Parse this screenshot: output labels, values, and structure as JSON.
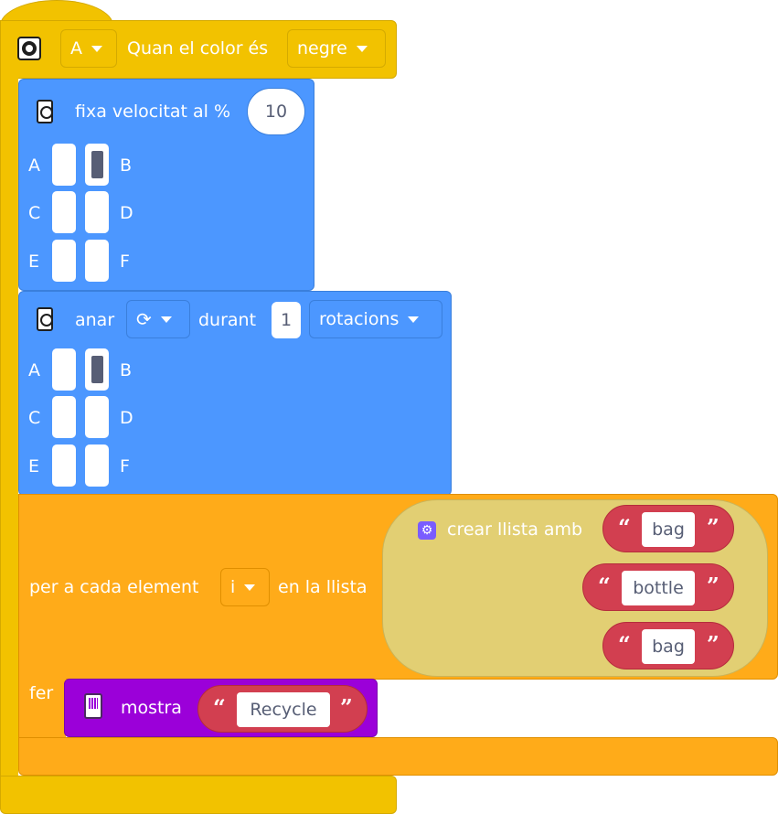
{
  "event_block": {
    "port": "A",
    "label": "Quan el color és",
    "color_value": "negre"
  },
  "speed_block": {
    "label": "fixa velocitat al %",
    "value": "10",
    "ports": {
      "a": "A",
      "b": "B",
      "c": "C",
      "d": "D",
      "e": "E",
      "f": "F"
    },
    "selected_port": "B"
  },
  "run_block": {
    "label": "anar",
    "direction_icon": "clockwise-icon",
    "during_label": "durant",
    "amount": "1",
    "unit": "rotacions",
    "ports": {
      "a": "A",
      "b": "B",
      "c": "C",
      "d": "D",
      "e": "E",
      "f": "F"
    },
    "selected_port": "B"
  },
  "loop_block": {
    "label": "per a cada element",
    "variable": "i",
    "in_list_label": "en la llista",
    "do_label": "fer"
  },
  "list_block": {
    "label": "crear llista amb",
    "items": [
      "bag",
      "bottle",
      "bag"
    ]
  },
  "display_block": {
    "label": "mostra",
    "text": "Recycle"
  },
  "colors": {
    "events": "#f2c200",
    "motors": "#4c97ff",
    "control": "#ffab19",
    "lists": "#e2cf73",
    "text": "#d23f50",
    "display": "#9b00d9"
  }
}
